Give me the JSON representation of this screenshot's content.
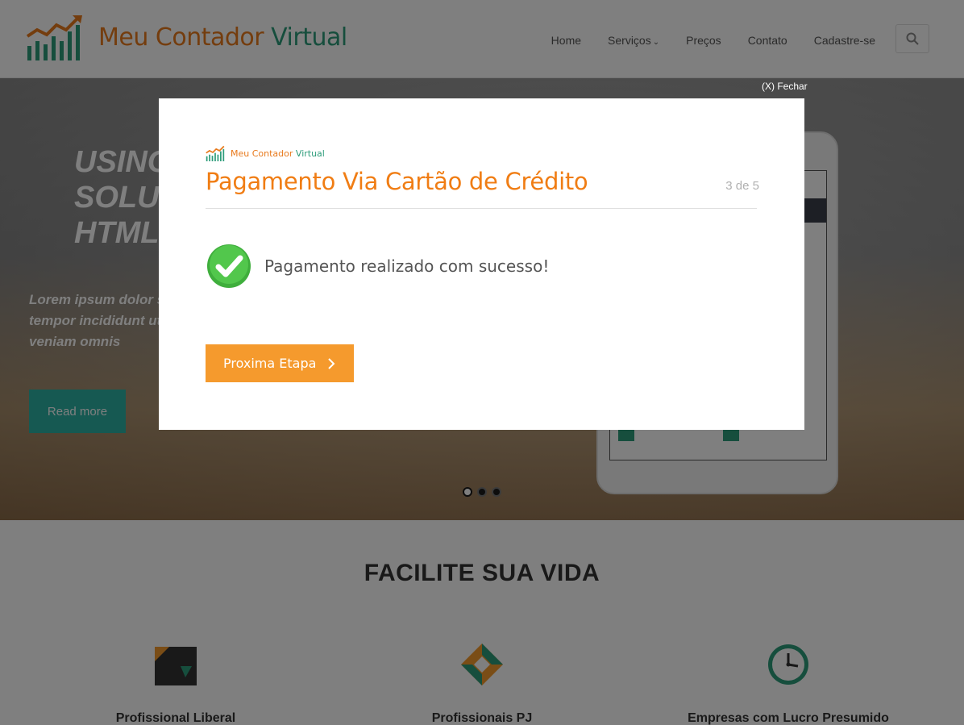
{
  "header": {
    "logo": {
      "word1": "Meu",
      "word2": "Contador",
      "word3": "Virtual"
    },
    "nav": [
      "Home",
      "Serviços",
      "Preços",
      "Contato",
      "Cadastre-se"
    ],
    "search_icon": "search-icon"
  },
  "hero": {
    "title_lines": [
      "USING",
      "SOLU",
      "HTML"
    ],
    "subtitle_lines": [
      "Lorem ipsum dolor s",
      "tempor incididunt ut",
      "veniam omnis"
    ],
    "read_more": "Read more",
    "slides": 3,
    "active_slide": 1
  },
  "section": {
    "title": "FACILITE SUA VIDA",
    "features": [
      {
        "title": "Profissional Liberal",
        "icon": "briefcase-icon"
      },
      {
        "title": "Profissionais PJ",
        "icon": "diamond-icon"
      },
      {
        "title": "Empresas com Lucro Presumido",
        "icon": "clock-icon"
      }
    ]
  },
  "modal": {
    "close": "(X) Fechar",
    "logo": {
      "word1": "Meu",
      "word2": "Contador",
      "word3": "Virtual"
    },
    "title": "Pagamento Via Cartão de Crédito",
    "step": "3 de 5",
    "message": "Pagamento realizado com sucesso!",
    "button": "Proxima Etapa"
  },
  "colors": {
    "brand_orange": "#f07d14",
    "brand_green": "#2d9c7a",
    "button_orange": "#f59a2d",
    "read_more_teal": "#2cb3a5"
  }
}
